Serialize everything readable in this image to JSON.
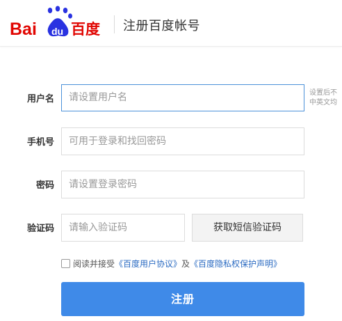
{
  "header": {
    "logo": {
      "text_bai": "Bai",
      "text_du": "du",
      "text_cn": "百度"
    },
    "title": "注册百度帐号"
  },
  "form": {
    "username": {
      "label": "用户名",
      "placeholder": "请设置用户名",
      "hint_line1": "设置后不",
      "hint_line2": "中英文均"
    },
    "phone": {
      "label": "手机号",
      "placeholder": "可用于登录和找回密码"
    },
    "password": {
      "label": "密码",
      "placeholder": "请设置登录密码"
    },
    "captcha": {
      "label": "验证码",
      "placeholder": "请输入验证码",
      "sms_button": "获取短信验证码"
    }
  },
  "agreement": {
    "prefix": "阅读并接受",
    "link1": "《百度用户协议》",
    "and": "及",
    "link2": "《百度隐私权保护声明》"
  },
  "submit_label": "注册",
  "colors": {
    "accent": "#3f8ae8",
    "baidu_red": "#e10602",
    "baidu_blue": "#2932e1",
    "link": "#2b6bc2"
  }
}
